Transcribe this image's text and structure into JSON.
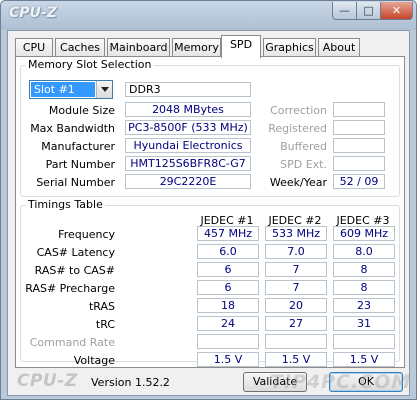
{
  "window": {
    "title": "CPU-Z",
    "minimize_glyph": "—",
    "maximize_glyph": "□",
    "close_glyph": "✕",
    "accent_color": "#b9c9da"
  },
  "tabs": [
    {
      "label": "CPU"
    },
    {
      "label": "Caches"
    },
    {
      "label": "Mainboard"
    },
    {
      "label": "Memory"
    },
    {
      "label": "SPD",
      "active": true
    },
    {
      "label": "Graphics"
    },
    {
      "label": "About"
    }
  ],
  "slot": {
    "group_label": "Memory Slot Selection",
    "selected": "Slot #1",
    "type": "DDR3",
    "module_size_label": "Module Size",
    "module_size": "2048 MBytes",
    "max_bandwidth_label": "Max Bandwidth",
    "max_bandwidth": "PC3-8500F (533 MHz)",
    "manufacturer_label": "Manufacturer",
    "manufacturer": "Hyundai Electronics",
    "part_number_label": "Part Number",
    "part_number": "HMT125S6BFR8C-G7",
    "serial_number_label": "Serial Number",
    "serial_number": "29C2220E",
    "correction_label": "Correction",
    "registered_label": "Registered",
    "buffered_label": "Buffered",
    "spd_ext_label": "SPD Ext.",
    "week_year_label": "Week/Year",
    "week_year": "52 / 09"
  },
  "timings": {
    "group_label": "Timings Table",
    "columns": [
      "JEDEC #1",
      "JEDEC #2",
      "JEDEC #3"
    ],
    "rows": [
      {
        "label": "Frequency",
        "values": [
          "457 MHz",
          "533 MHz",
          "609 MHz"
        ]
      },
      {
        "label": "CAS# Latency",
        "values": [
          "6.0",
          "7.0",
          "8.0"
        ]
      },
      {
        "label": "RAS# to CAS#",
        "values": [
          "6",
          "7",
          "8"
        ]
      },
      {
        "label": "RAS# Precharge",
        "values": [
          "6",
          "7",
          "8"
        ]
      },
      {
        "label": "tRAS",
        "values": [
          "18",
          "20",
          "23"
        ]
      },
      {
        "label": "tRC",
        "values": [
          "24",
          "27",
          "31"
        ]
      },
      {
        "label": "Command Rate",
        "values": [
          "",
          "",
          ""
        ],
        "disabled": true
      },
      {
        "label": "Voltage",
        "values": [
          "1.5 V",
          "1.5 V",
          "1.5 V"
        ]
      }
    ]
  },
  "footer": {
    "logo": "CPU-Z",
    "version": "Version 1.52.2",
    "validate_label": "Validate",
    "ok_label": "OK",
    "watermark": "TIP4PC.COM"
  }
}
